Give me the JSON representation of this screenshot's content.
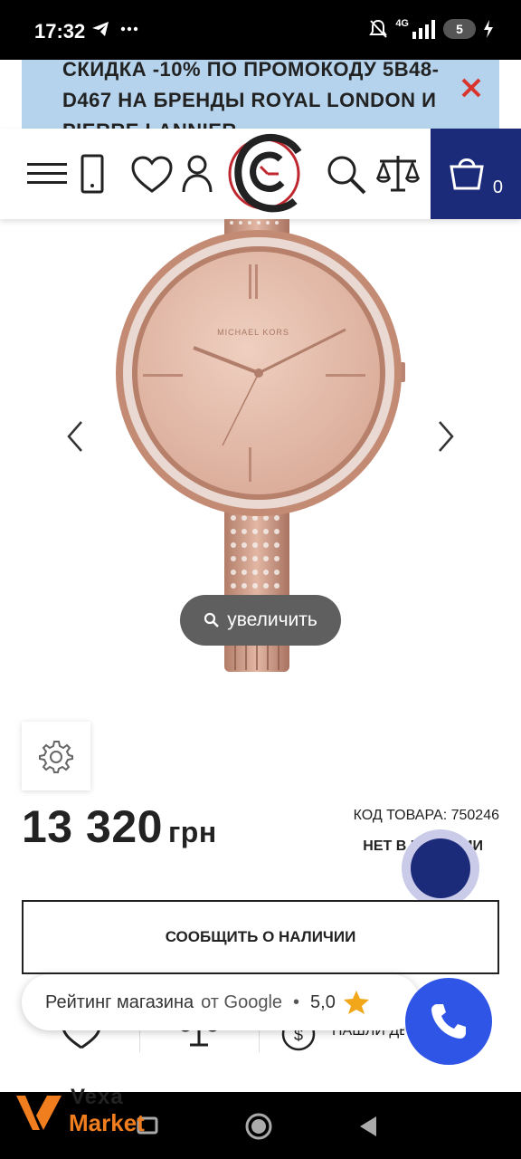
{
  "status_bar": {
    "time": "17:32",
    "network": "4G",
    "battery": "5"
  },
  "promo": {
    "text": "СКИДКА -10% ПО ПРОМОКОДУ 5B48-D467 НА БРЕНДЫ ROYAL LONDON И PIERRE LANNIER"
  },
  "header": {
    "cart_count": "0"
  },
  "product": {
    "zoom_label": "увеличить",
    "dial_brand": "MICHAEL KORS",
    "price": "13 320",
    "currency": "грн",
    "sku": "КОД ТОВАРА: 750246",
    "availability": "НЕТ В НАЛИЧИИ",
    "notify_label": "СООБЩИТЬ О НАЛИЧИИ",
    "found_cheaper": "НАШЛИ ДЕШЕВЛЕ?"
  },
  "rating": {
    "prefix": "Рейтинг магазина",
    "source": "от Google",
    "separator": "•",
    "score": "5,0"
  },
  "brand": {
    "top": "Vexa",
    "bottom": "Market"
  },
  "colors": {
    "accent": "#1c2a7a",
    "promo_bg": "#b5d3ec",
    "call": "#2e55e6",
    "brand_orange": "#f07e1e",
    "close_red": "#d9342b"
  }
}
